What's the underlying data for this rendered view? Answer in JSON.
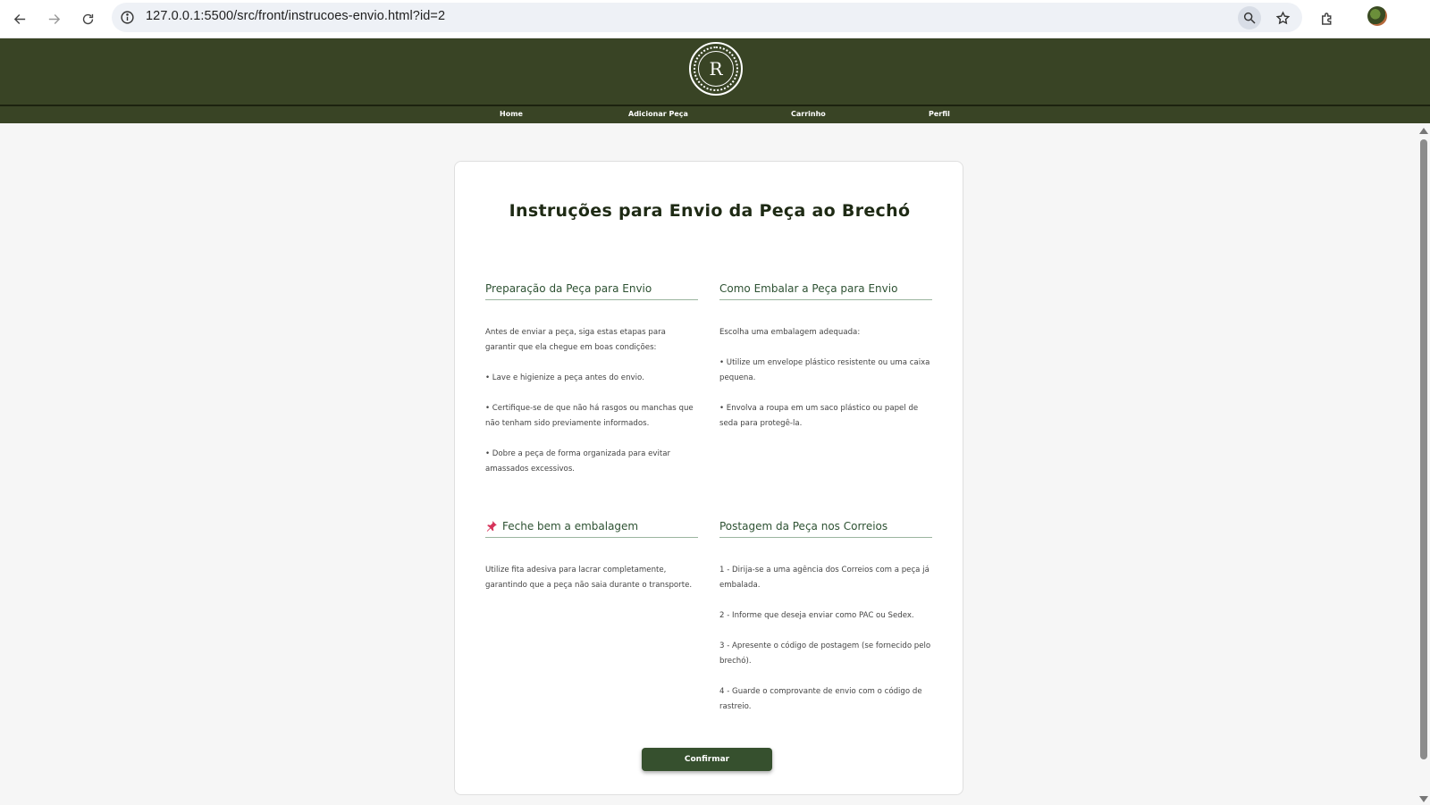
{
  "browser": {
    "url": "127.0.0.1:5500/src/front/instrucoes-envio.html?id=2"
  },
  "header": {
    "logo_letter": "R",
    "nav": [
      {
        "label": "Home"
      },
      {
        "label": "Adicionar Peça"
      },
      {
        "label": "Carrinho"
      },
      {
        "label": "Perfil"
      }
    ]
  },
  "main": {
    "title": "Instruções para Envio da Peça ao Brechó",
    "sections": [
      {
        "heading": "Preparação da Peça para Envio",
        "paragraphs": [
          "Antes de enviar a peça, siga estas etapas para garantir que ela chegue em boas condições:",
          "• Lave e higienize a peça antes do envio.",
          "• Certifique-se de que não há rasgos ou manchas que não tenham sido previamente informados.",
          "• Dobre a peça de forma organizada para evitar amassados excessivos."
        ]
      },
      {
        "heading": "Como Embalar a Peça para Envio",
        "paragraphs": [
          "Escolha uma embalagem adequada:",
          "• Utilize um envelope plástico resistente ou uma caixa pequena.",
          "• Envolva a roupa em um saco plástico ou papel de seda para protegê-la."
        ]
      },
      {
        "heading": "Feche bem a embalagem",
        "icon": "pushpin-icon",
        "paragraphs": [
          "Utilize fita adesiva para lacrar completamente, garantindo que a peça não saia durante o transporte."
        ]
      },
      {
        "heading": "Postagem da Peça nos Correios",
        "paragraphs": [
          "1 - Dirija-se a uma agência dos Correios com a peça já embalada.",
          "2 - Informe que deseja enviar como PAC ou Sedex.",
          "3 - Apresente o código de postagem (se fornecido pelo brechó).",
          "4 - Guarde o comprovante de envio com o código de rastreio."
        ]
      }
    ],
    "confirm_label": "Confirmar"
  },
  "colors": {
    "header_bg": "#394425",
    "heading_green": "#2e5233",
    "button_bg": "#36502e",
    "pin_red": "#d6335a"
  }
}
